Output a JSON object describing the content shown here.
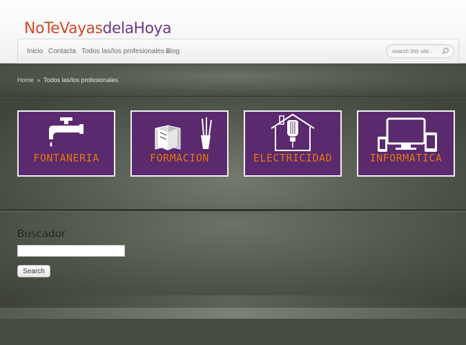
{
  "header": {
    "logo_part1": "NoTeVayas",
    "logo_part2": "delaHoya",
    "nav": [
      "Inicio",
      "Contacta",
      "Todos las/los profesionales »",
      "Blog"
    ],
    "search_placeholder": "search this site..."
  },
  "breadcrumb": {
    "home": "Home",
    "separator": "»",
    "current": "Todos las/los profesionales"
  },
  "categories": [
    {
      "label": "FONTANERIA",
      "icon": "faucet-icon"
    },
    {
      "label": "FORMACION",
      "icon": "books-pencils-icon"
    },
    {
      "label": "ELECTRICIDAD",
      "icon": "house-bulb-icon"
    },
    {
      "label": "INFORMATICA",
      "icon": "devices-icon"
    }
  ],
  "widget": {
    "title": "Buscador",
    "button_label": "Search"
  },
  "colors": {
    "card_bg": "#5b2a6e",
    "card_label": "#e97a1d",
    "logo_orange": "#d0492a",
    "logo_purple": "#6f3a8a"
  }
}
